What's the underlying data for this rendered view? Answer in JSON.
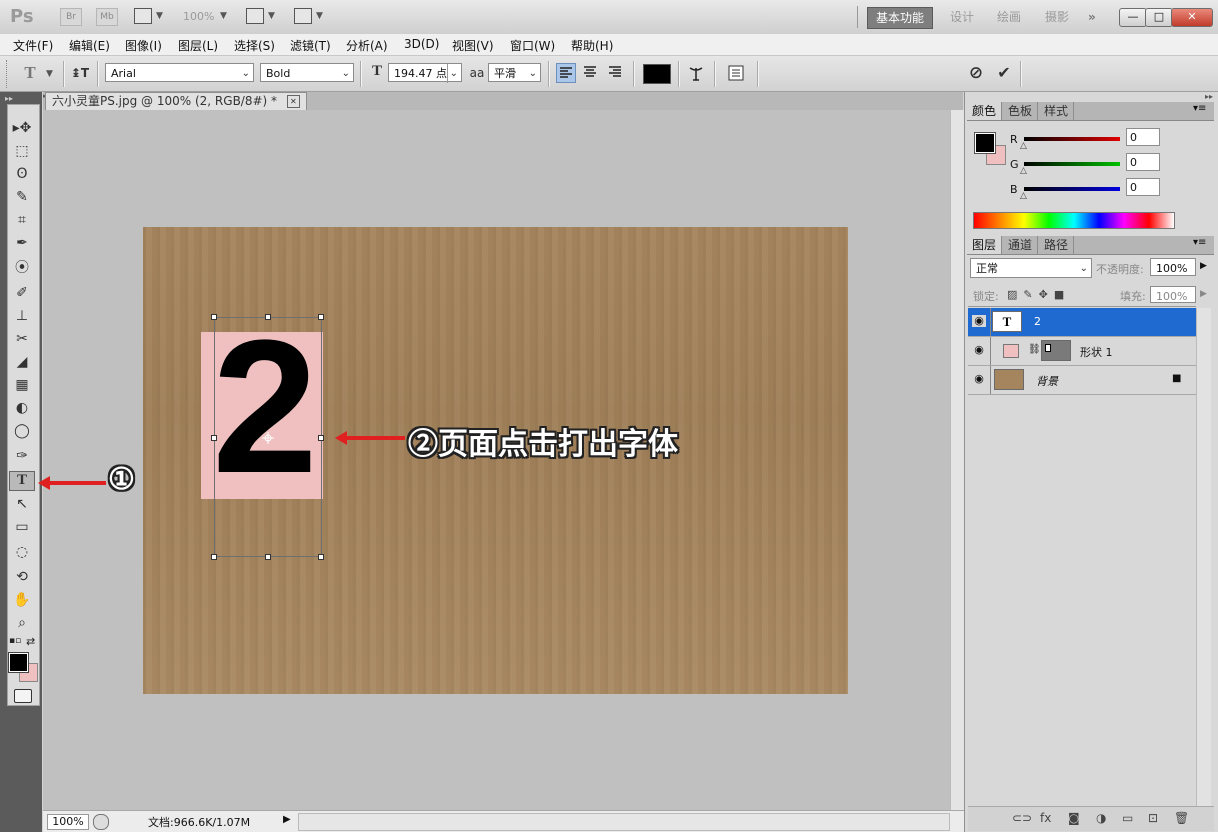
{
  "appbar": {
    "logo": "Ps",
    "bridge_label": "Br",
    "minibridge_label": "Mb",
    "zoom": "100%",
    "workspaces": [
      "基本功能",
      "设计",
      "绘画",
      "摄影"
    ],
    "more": "»",
    "win_min": "—",
    "win_max": "□",
    "win_close": "✕"
  },
  "menu": [
    "文件(F)",
    "编辑(E)",
    "图像(I)",
    "图层(L)",
    "选择(S)",
    "滤镜(T)",
    "分析(A)",
    "3D(D)",
    "视图(V)",
    "窗口(W)",
    "帮助(H)"
  ],
  "options": {
    "tool_glyph": "T",
    "orient_glyph": "↨T",
    "font_family": "Arial",
    "font_style": "Bold",
    "size_glyph": "T",
    "font_size": "194.47 点",
    "aa_label": "aa",
    "antialias": "平滑",
    "color_hex": "#000000",
    "cancel_glyph": "⊘",
    "commit_glyph": "✔"
  },
  "document": {
    "tab_title": "六小灵童PS.jpg @ 100% (2, RGB/8#) *",
    "tab_close": "✕",
    "digit": "2",
    "zoom_field": "100%",
    "doc_info": "文档:966.6K/1.07M"
  },
  "annotations": {
    "one": "←①",
    "two": "←②页面点击打出字体",
    "arrow_color": "#e02020"
  },
  "toolbox": {
    "tools": [
      "▸✥",
      "⬚",
      "ʘ",
      "✎",
      "⌗",
      "✒",
      "⦿",
      "✐",
      "⊥",
      "✂",
      "◢",
      "▦",
      "◐",
      "◯",
      "✑",
      "T",
      "↖",
      "▭",
      "◌",
      "⟲",
      "✋",
      "⌕"
    ],
    "fg_color": "#000000",
    "bg_color": "#f0c0c0"
  },
  "color_panel": {
    "tabs": [
      "颜色",
      "色板",
      "样式"
    ],
    "channels": [
      {
        "label": "R",
        "value": "0",
        "color": "#e00000"
      },
      {
        "label": "G",
        "value": "0",
        "color": "#00c000"
      },
      {
        "label": "B",
        "value": "0",
        "color": "#0000e0"
      }
    ]
  },
  "layers_panel": {
    "tabs": [
      "图层",
      "通道",
      "路径"
    ],
    "blend_mode": "正常",
    "opacity_label": "不透明度:",
    "opacity": "100%",
    "lock_label": "锁定:",
    "fill_label": "填充:",
    "fill": "100%",
    "layers": [
      {
        "name": "2",
        "thumb_glyph": "T",
        "selected": true
      },
      {
        "name": "形状 1",
        "selected": false
      },
      {
        "name": "背景",
        "selected": false
      }
    ],
    "footer_icons": [
      "link-icon",
      "fx-icon",
      "mask-icon",
      "adjustment-icon",
      "group-icon",
      "new-layer-icon",
      "trash-icon"
    ],
    "footer_glyphs": [
      "⊂⊃",
      "fx",
      "◙",
      "◑",
      "▭",
      "⊡",
      "🗑"
    ]
  }
}
